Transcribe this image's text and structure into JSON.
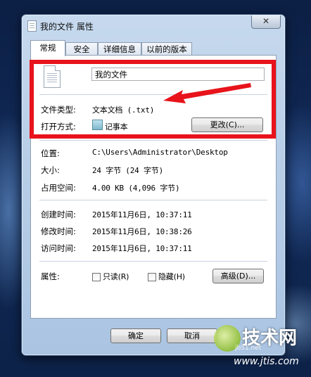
{
  "window": {
    "title": "我的文件 属性",
    "close_label": "✕"
  },
  "tabs": [
    {
      "label": "常规",
      "active": true
    },
    {
      "label": "安全",
      "active": false
    },
    {
      "label": "详细信息",
      "active": false
    },
    {
      "label": "以前的版本",
      "active": false
    }
  ],
  "general": {
    "file_name": "我的文件",
    "type_label": "文件类型:",
    "type_value": "文本文档 (.txt)",
    "opens_with_label": "打开方式:",
    "opens_with_value": "记事本",
    "change_button": "更改(C)...",
    "location_label": "位置:",
    "location_value": "C:\\Users\\Administrator\\Desktop",
    "size_label": "大小:",
    "size_value": "24 字节 (24 字节)",
    "size_on_disk_label": "占用空间:",
    "size_on_disk_value": "4.00 KB (4,096 字节)",
    "created_label": "创建时间:",
    "created_value": "2015年11月6日, 10:37:11",
    "modified_label": "修改时间:",
    "modified_value": "2015年11月6日, 10:38:26",
    "accessed_label": "访问时间:",
    "accessed_value": "2015年11月6日, 10:37:11",
    "attributes_label": "属性:",
    "readonly_label": "只读(R)",
    "hidden_label": "隐藏(H)",
    "advanced_button": "高级(D)..."
  },
  "footer": {
    "ok_button": "确定",
    "cancel_button": "取消"
  },
  "annotation": {
    "highlight_color": "#e8131b"
  },
  "watermark": {
    "line1": "技术网",
    "line2": "jb51.net",
    "line3": "www.jtis.com"
  }
}
